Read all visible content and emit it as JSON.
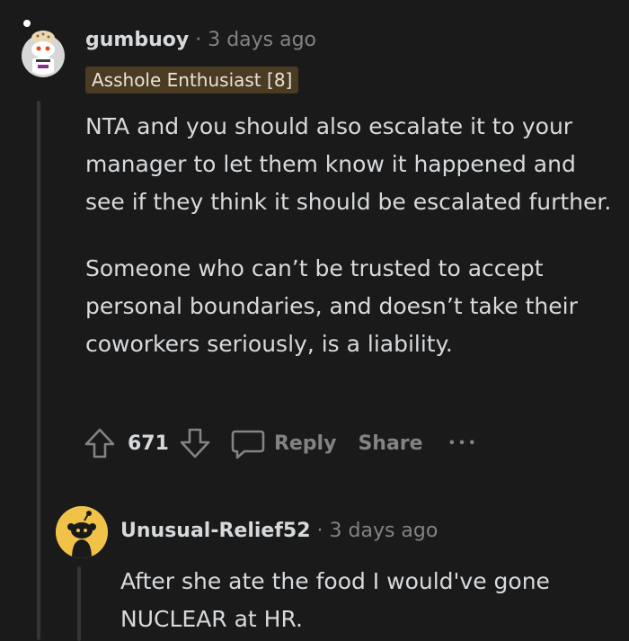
{
  "comment": {
    "author": "gumbuoy",
    "separator": "·",
    "time": "3 days ago",
    "flair": "Asshole Enthusiast [8]",
    "paragraphs": [
      "NTA and you should also escalate it to your manager to let them know it happened and see if they think it should be escalated further.",
      "Someone who can’t be trusted to accept personal boundaries, and doesn’t take their coworkers seriously, is a liability."
    ],
    "votes": "671",
    "reply_label": "Reply",
    "share_label": "Share",
    "more_label": "•••"
  },
  "reply": {
    "author": "Unusual-Relief52",
    "separator": "·",
    "time": "3 days ago",
    "paragraphs": [
      "After she ate the food I would've gone NUCLEAR at HR."
    ]
  },
  "colors": {
    "background": "#1a1a1b",
    "text": "#d7dadc",
    "muted": "#818384",
    "flair_bg": "#4b3b22",
    "thread_line": "#343536",
    "reply_avatar_bg": "#f0c348"
  },
  "icons": {
    "upvote": "upvote-arrow-icon",
    "downvote": "downvote-arrow-icon",
    "comment": "speech-bubble-icon",
    "more": "ellipsis-icon"
  }
}
